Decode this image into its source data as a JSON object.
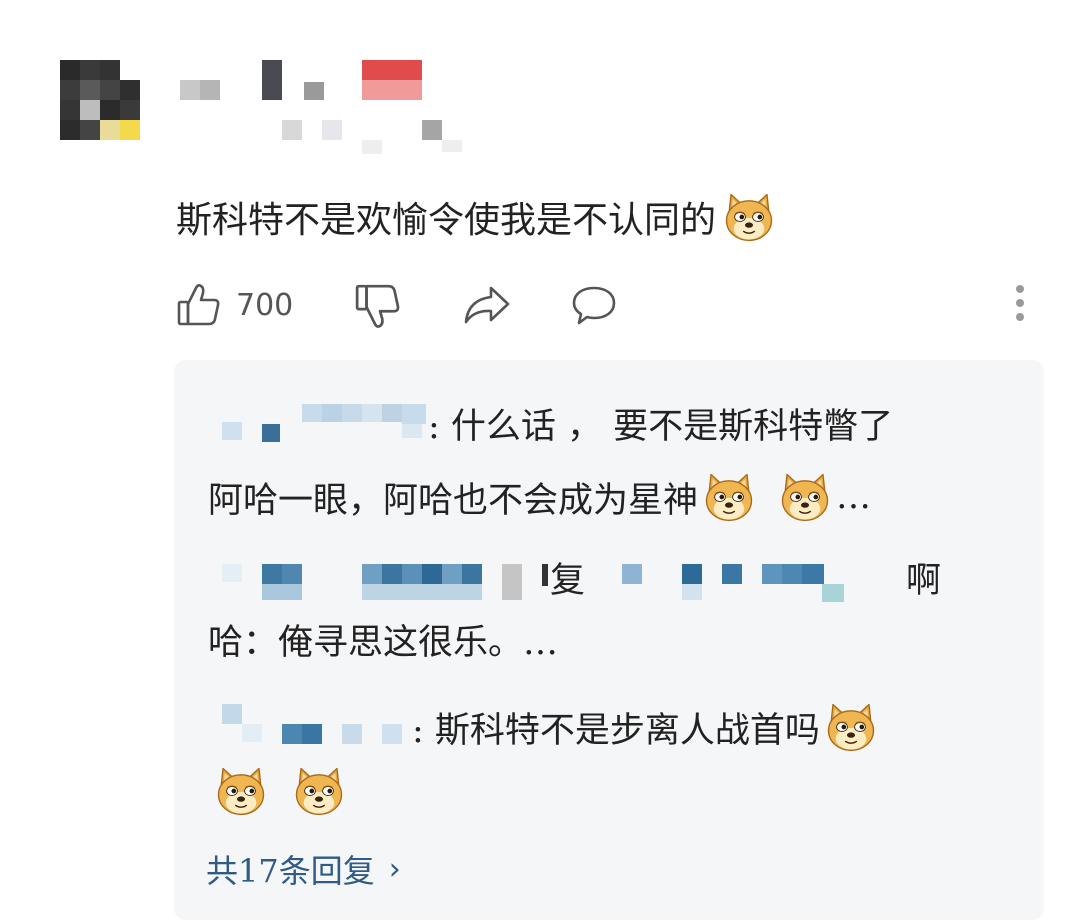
{
  "comment": {
    "text": "斯科特不是欢愉令使我是不认同的",
    "emoji": "doge-emoji",
    "like_count": "700",
    "icons": {
      "like": "thumbs-up-icon",
      "dislike": "thumbs-down-icon",
      "share": "share-icon",
      "reply": "comment-icon",
      "more": "more-vertical-icon"
    }
  },
  "replies": [
    {
      "line1": ": 什么话 ， 要不是斯科特瞥了",
      "line2": "阿哈一眼，阿哈也不会成为星神",
      "line2_suffix": "…"
    },
    {
      "line1_mid": "复",
      "line1_end": "啊",
      "line2": "哈：俺寻思这很乐。…"
    },
    {
      "line1": ": 斯科特不是步离人战首吗"
    }
  ],
  "see_more": {
    "label": "共17条回复",
    "chevron": "›"
  },
  "colors": {
    "reply_box_bg": "#f5f6f8",
    "link_blue": "#2f5b86",
    "blur_blue": "#3f7fb0"
  }
}
